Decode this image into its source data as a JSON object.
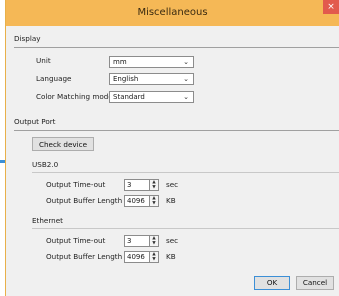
{
  "window": {
    "title": "Miscellaneous",
    "close_glyph": "×"
  },
  "display": {
    "heading": "Display",
    "unit": {
      "label": "Unit",
      "value": "mm"
    },
    "language": {
      "label": "Language",
      "value": "English"
    },
    "color_matching": {
      "label": "Color Matching mode",
      "value": "Standard"
    }
  },
  "output_port": {
    "heading": "Output Port",
    "check_device_label": "Check device",
    "usb": {
      "heading": "USB2.0",
      "timeout_label": "Output Time-out",
      "timeout_value": "3",
      "timeout_unit": "sec",
      "buffer_label": "Output Buffer Length",
      "buffer_value": "4096",
      "buffer_unit": "KB"
    },
    "ethernet": {
      "heading": "Ethernet",
      "timeout_label": "Output Time-out",
      "timeout_value": "3",
      "timeout_unit": "sec",
      "buffer_label": "Output Buffer Length",
      "buffer_value": "4096",
      "buffer_unit": "KB"
    }
  },
  "footer": {
    "ok_label": "OK",
    "cancel_label": "Cancel"
  },
  "icons": {
    "dropdown": "chevron-down-icon",
    "spin_up": "▲",
    "spin_down": "▼"
  }
}
